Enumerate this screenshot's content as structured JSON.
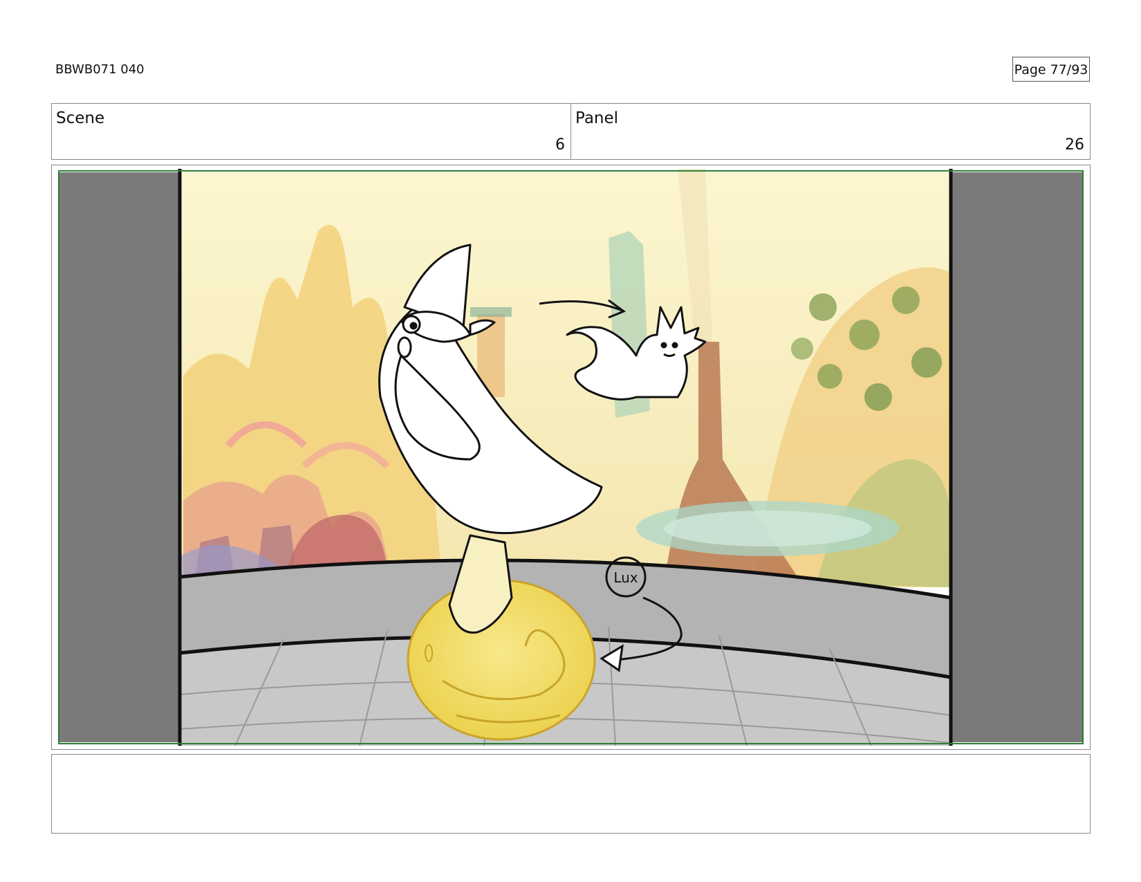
{
  "header": {
    "doc_code": "BBWB071 040",
    "page_label": "Page 77/93"
  },
  "info": {
    "scene_label": "Scene",
    "scene_value": "6",
    "panel_label": "Panel",
    "panel_value": "26"
  },
  "frame": {
    "annotation": "Lux",
    "colors": {
      "safe_area_border": "#2e7d32",
      "side_mask": "#7a7a7a",
      "bubble": "#f3dc5c",
      "sky": "#fbf3c8"
    },
    "icons": [
      "wizard-sketch-icon",
      "ghost-sketch-icon",
      "bubble-icon",
      "motion-arrow-icon"
    ]
  },
  "notes": {
    "text": ""
  }
}
